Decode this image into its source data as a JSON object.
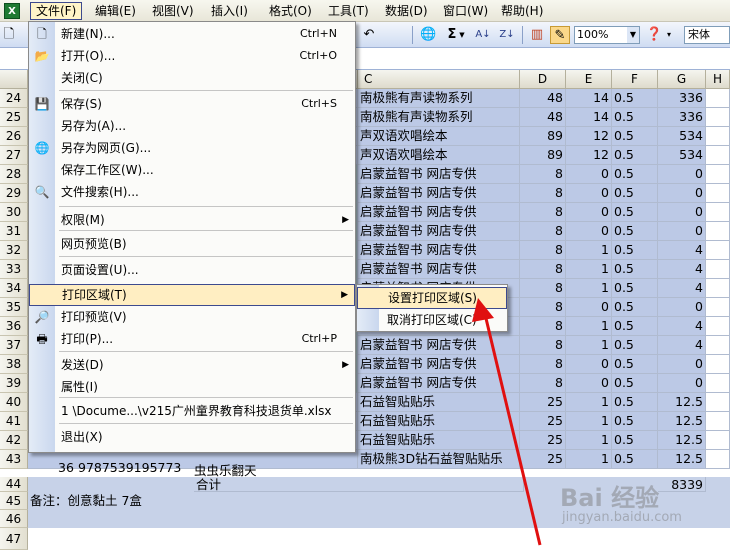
{
  "menubar": {
    "items": [
      "文件(F)",
      "编辑(E)",
      "视图(V)",
      "插入(I)",
      "格式(O)",
      "工具(T)",
      "数据(D)",
      "窗口(W)",
      "帮助(H)"
    ]
  },
  "toolbar": {
    "zoom": "100%",
    "font": "宋体",
    "sigma": "Σ"
  },
  "columns": [
    "C",
    "D",
    "E",
    "F",
    "G",
    "H"
  ],
  "rows": [
    {
      "num": "24",
      "c": "南极熊有声读物系列",
      "d": "48",
      "e": "14",
      "f": "0.5",
      "g": "336",
      "style": "blue"
    },
    {
      "num": "25",
      "c": "南极熊有声读物系列",
      "d": "48",
      "e": "14",
      "f": "0.5",
      "g": "336",
      "style": "blue"
    },
    {
      "num": "26",
      "c": "声双语欢唱绘本",
      "d": "89",
      "e": "12",
      "f": "0.5",
      "g": "534",
      "style": "blue"
    },
    {
      "num": "27",
      "c": "声双语欢唱绘本",
      "d": "89",
      "e": "12",
      "f": "0.5",
      "g": "534",
      "style": "blue"
    },
    {
      "num": "28",
      "c": "启蒙益智书 网店专供",
      "d": "8",
      "e": "0",
      "f": "0.5",
      "g": "0",
      "style": "teal"
    },
    {
      "num": "29",
      "c": "启蒙益智书 网店专供",
      "d": "8",
      "e": "0",
      "f": "0.5",
      "g": "0",
      "style": "teal"
    },
    {
      "num": "30",
      "c": "启蒙益智书 网店专供",
      "d": "8",
      "e": "0",
      "f": "0.5",
      "g": "0",
      "style": "teal"
    },
    {
      "num": "31",
      "c": "启蒙益智书 网店专供",
      "d": "8",
      "e": "0",
      "f": "0.5",
      "g": "0",
      "style": "teal"
    },
    {
      "num": "32",
      "c": "启蒙益智书 网店专供",
      "d": "8",
      "e": "1",
      "f": "0.5",
      "g": "4",
      "style": "teal"
    },
    {
      "num": "33",
      "c": "启蒙益智书 网店专供",
      "d": "8",
      "e": "1",
      "f": "0.5",
      "g": "4",
      "style": "teal"
    },
    {
      "num": "34",
      "c": "启蒙益智书 网店专供",
      "d": "8",
      "e": "1",
      "f": "0.5",
      "g": "4",
      "style": "teal"
    },
    {
      "num": "35",
      "c": "",
      "d": "8",
      "e": "0",
      "f": "0.5",
      "g": "0",
      "style": "teal"
    },
    {
      "num": "36",
      "c": "",
      "d": "8",
      "e": "1",
      "f": "0.5",
      "g": "4",
      "style": "teal"
    },
    {
      "num": "37",
      "c": "启蒙益智书 网店专供",
      "d": "8",
      "e": "1",
      "f": "0.5",
      "g": "4",
      "style": "teal"
    },
    {
      "num": "38",
      "c": "启蒙益智书 网店专供",
      "d": "8",
      "e": "0",
      "f": "0.5",
      "g": "0",
      "style": "teal"
    },
    {
      "num": "39",
      "c": "启蒙益智书 网店专供",
      "d": "8",
      "e": "0",
      "f": "0.5",
      "g": "0",
      "style": "teal"
    },
    {
      "num": "40",
      "c": "石益智贴贴乐",
      "d": "25",
      "e": "1",
      "f": "0.5",
      "g": "12.5",
      "style": "blue"
    },
    {
      "num": "41",
      "c": "石益智贴贴乐",
      "d": "25",
      "e": "1",
      "f": "0.5",
      "g": "12.5",
      "style": "blue"
    },
    {
      "num": "42",
      "c": "石益智贴贴乐",
      "d": "25",
      "e": "1",
      "f": "0.5",
      "g": "12.5",
      "style": "blue"
    },
    {
      "num": "43",
      "c": "南极熊3D钻石益智贴贴乐",
      "d": "25",
      "e": "1",
      "f": "0.5",
      "g": "12.5",
      "style": "blue"
    }
  ],
  "row43_extra": {
    "a": "36",
    "b": "9787539195773",
    "b2": "虫虫乐翻天"
  },
  "row44": {
    "num": "44",
    "b": "合计",
    "g": "8339"
  },
  "row45": {
    "num": "45",
    "a": "备注：创意黏土 7盒"
  },
  "row46": {
    "num": "46"
  },
  "row47": {
    "num": "47"
  },
  "file_menu": {
    "items": [
      {
        "label": "新建(N)...",
        "shortcut": "Ctrl+N",
        "icon": "new-file-icon",
        "glyph": "🗋"
      },
      {
        "label": "打开(O)...",
        "shortcut": "Ctrl+O",
        "icon": "open-folder-icon",
        "glyph": "📂"
      },
      {
        "label": "关闭(C)",
        "shortcut": "",
        "icon": "",
        "glyph": ""
      },
      {
        "label": "保存(S)",
        "shortcut": "Ctrl+S",
        "icon": "save-icon",
        "glyph": "💾"
      },
      {
        "label": "另存为(A)...",
        "shortcut": "",
        "icon": "",
        "glyph": ""
      },
      {
        "label": "另存为网页(G)...",
        "shortcut": "",
        "icon": "web-page-icon",
        "glyph": "🌐"
      },
      {
        "label": "保存工作区(W)...",
        "shortcut": "",
        "icon": "",
        "glyph": ""
      },
      {
        "label": "文件搜索(H)...",
        "shortcut": "",
        "icon": "file-search-icon",
        "glyph": "🔍"
      },
      {
        "label": "权限(M)",
        "shortcut": "",
        "icon": "",
        "glyph": ""
      },
      {
        "label": "网页预览(B)",
        "shortcut": "",
        "icon": "",
        "glyph": ""
      },
      {
        "label": "页面设置(U)...",
        "shortcut": "",
        "icon": "",
        "glyph": ""
      },
      {
        "label": "打印区域(T)",
        "shortcut": "",
        "icon": "",
        "glyph": ""
      },
      {
        "label": "打印预览(V)",
        "shortcut": "",
        "icon": "print-preview-icon",
        "glyph": "🔎"
      },
      {
        "label": "打印(P)...",
        "shortcut": "Ctrl+P",
        "icon": "printer-icon",
        "glyph": "🖶"
      },
      {
        "label": "发送(D)",
        "shortcut": "",
        "icon": "",
        "glyph": ""
      },
      {
        "label": "属性(I)",
        "shortcut": "",
        "icon": "",
        "glyph": ""
      },
      {
        "label": "1 \\Docume...\\v215广州童界教育科技退货单.xlsx",
        "shortcut": "",
        "icon": "",
        "glyph": ""
      },
      {
        "label": "退出(X)",
        "shortcut": "",
        "icon": "",
        "glyph": ""
      }
    ]
  },
  "submenu": {
    "items": [
      "设置打印区域(S)",
      "取消打印区域(C)"
    ]
  },
  "watermark": {
    "text": "Bai 经验",
    "sub": "jingyan.baidu.com"
  }
}
